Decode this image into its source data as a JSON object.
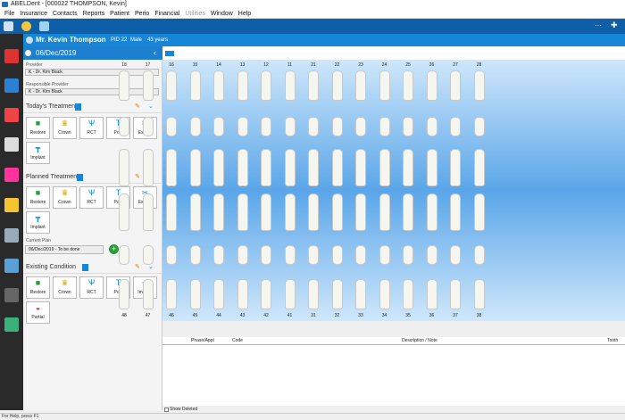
{
  "window": {
    "title": "ABELDent - [000022 THOMPSON, Kevin]"
  },
  "menu": [
    "File",
    "Insurance",
    "Contacts",
    "Reports",
    "Patient",
    "Perio",
    "Financial",
    "Utilities",
    "Window",
    "Help"
  ],
  "patient": {
    "name": "Mr. Kevin Thompson",
    "pid": "PID 22",
    "sex": "Male",
    "age": "43 years"
  },
  "date": "06/Dec/2019",
  "provider": {
    "label": "Provider",
    "value": "K - Dr. Kim Black"
  },
  "responsible": {
    "label": "Responsible Provider",
    "value": "K - Dr. Kim Black"
  },
  "sections": {
    "today": "Today's Treatment",
    "planned": "Planned Treatment",
    "existing": "Existing Condition"
  },
  "buttons": {
    "restore": "Restore",
    "crown": "Crown",
    "rct": "RCT",
    "post": "Post",
    "extract": "Extract",
    "implant": "Implant",
    "partial": "Partial"
  },
  "plan": {
    "label": "Current Plan",
    "value": "06/Dec/2019 - To be done"
  },
  "teeth_upper": [
    "18",
    "17",
    "16",
    "15",
    "14",
    "13",
    "12",
    "11",
    "21",
    "22",
    "23",
    "24",
    "25",
    "26",
    "27",
    "28"
  ],
  "teeth_lower": [
    "48",
    "47",
    "46",
    "45",
    "44",
    "43",
    "42",
    "41",
    "31",
    "32",
    "33",
    "34",
    "35",
    "36",
    "37",
    "38"
  ],
  "table": {
    "cols": [
      "Phase/Appt",
      "Code",
      "Description / Note",
      "Tooth"
    ]
  },
  "show_deleted": "Show Deleted",
  "status": "For Help, press F1"
}
